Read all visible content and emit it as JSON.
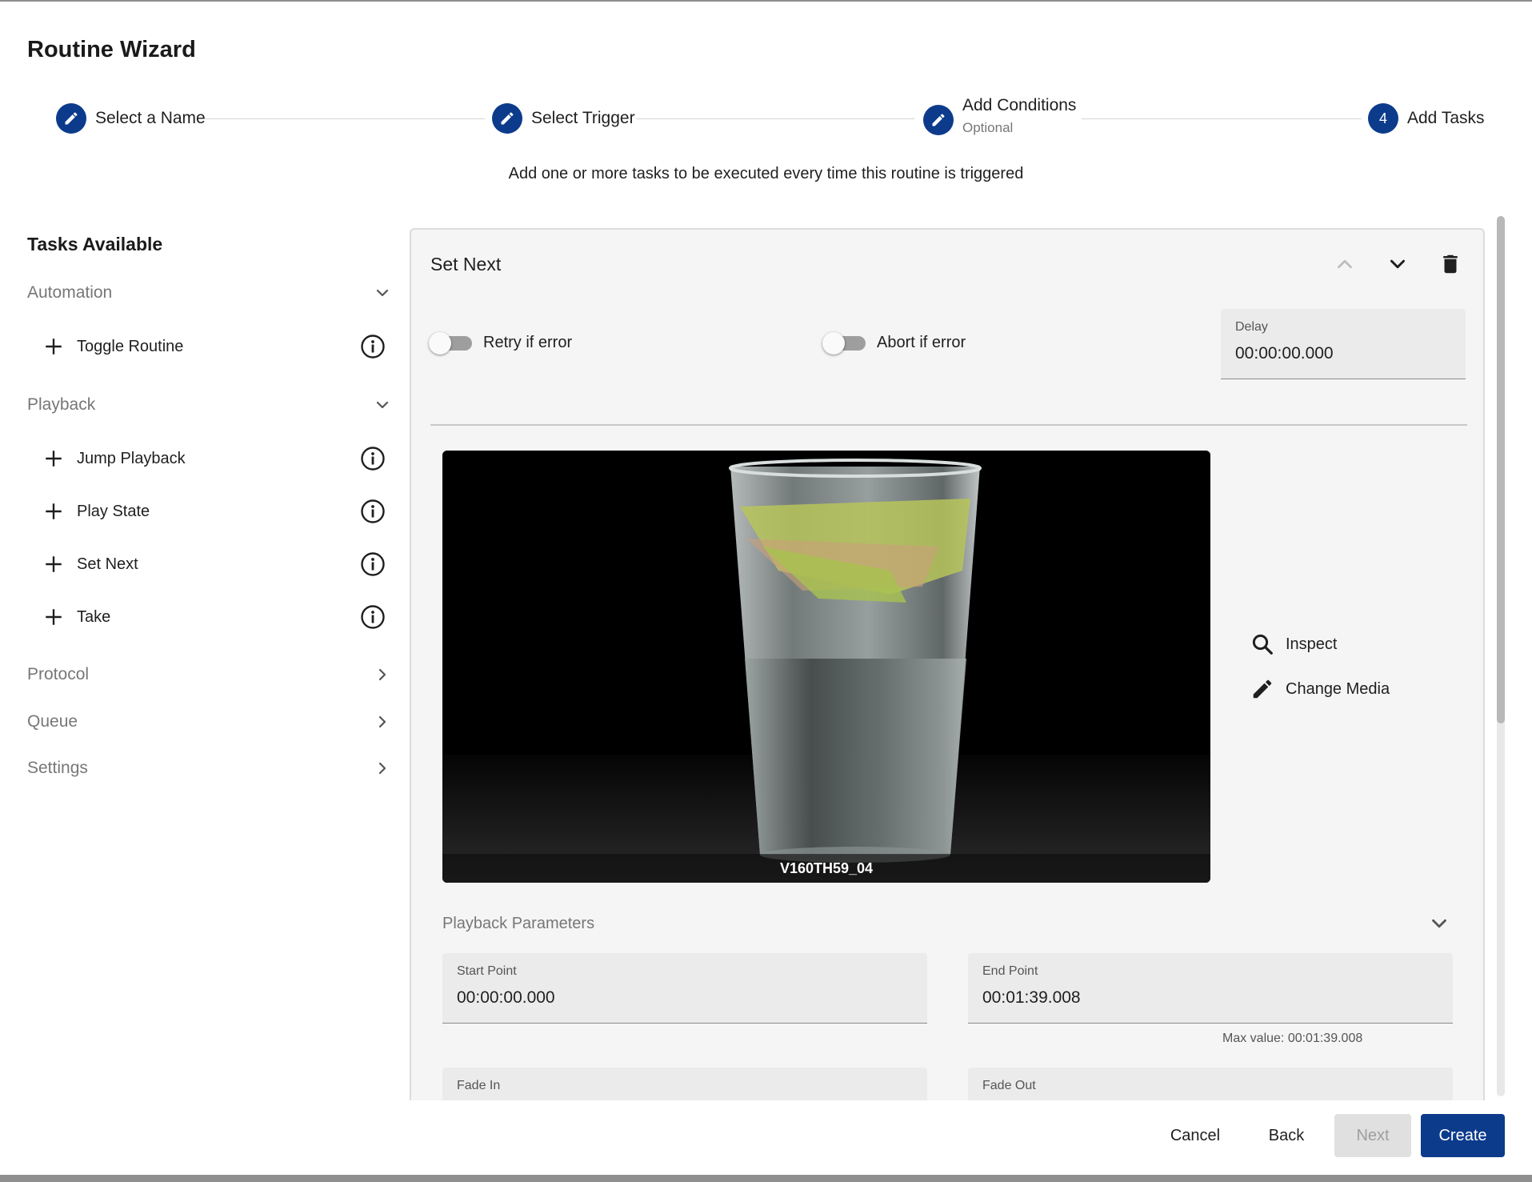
{
  "dialog": {
    "title": "Routine Wizard",
    "instruction": "Add one or more tasks to be executed every time this routine is triggered"
  },
  "stepper": {
    "steps": [
      {
        "label": "Select a Name",
        "icon": "pencil-icon",
        "state": "completed"
      },
      {
        "label": "Select Trigger",
        "icon": "pencil-icon",
        "state": "completed"
      },
      {
        "label": "Add Conditions",
        "sublabel": "Optional",
        "icon": "pencil-icon",
        "state": "completed"
      },
      {
        "label": "Add Tasks",
        "number": "4",
        "state": "active"
      }
    ]
  },
  "sidebar": {
    "title": "Tasks Available",
    "categories": [
      {
        "label": "Automation",
        "expanded": true,
        "tasks": [
          "Toggle Routine"
        ]
      },
      {
        "label": "Playback",
        "expanded": true,
        "tasks": [
          "Jump Playback",
          "Play State",
          "Set Next",
          "Take"
        ]
      },
      {
        "label": "Protocol",
        "expanded": false
      },
      {
        "label": "Queue",
        "expanded": false
      },
      {
        "label": "Settings",
        "expanded": false
      }
    ]
  },
  "task_panel": {
    "title": "Set Next",
    "retry_label": "Retry if error",
    "retry_on": false,
    "abort_label": "Abort if error",
    "abort_on": false,
    "delay": {
      "label": "Delay",
      "value": "00:00:00.000"
    },
    "media": {
      "caption": "V160TH59_04",
      "inspect_label": "Inspect",
      "change_label": "Change Media"
    },
    "playback_parameters": {
      "title": "Playback Parameters",
      "start_point": {
        "label": "Start Point",
        "value": "00:00:00.000"
      },
      "end_point": {
        "label": "End Point",
        "value": "00:01:39.008",
        "helper": "Max value: 00:01:39.008"
      },
      "fade_in": {
        "label": "Fade In"
      },
      "fade_out": {
        "label": "Fade Out"
      }
    }
  },
  "footer": {
    "cancel": "Cancel",
    "back": "Back",
    "next": "Next",
    "create": "Create"
  },
  "colors": {
    "primary": "#0d3b8c",
    "panel_bg": "#f5f5f5",
    "muted_text": "#777777"
  }
}
